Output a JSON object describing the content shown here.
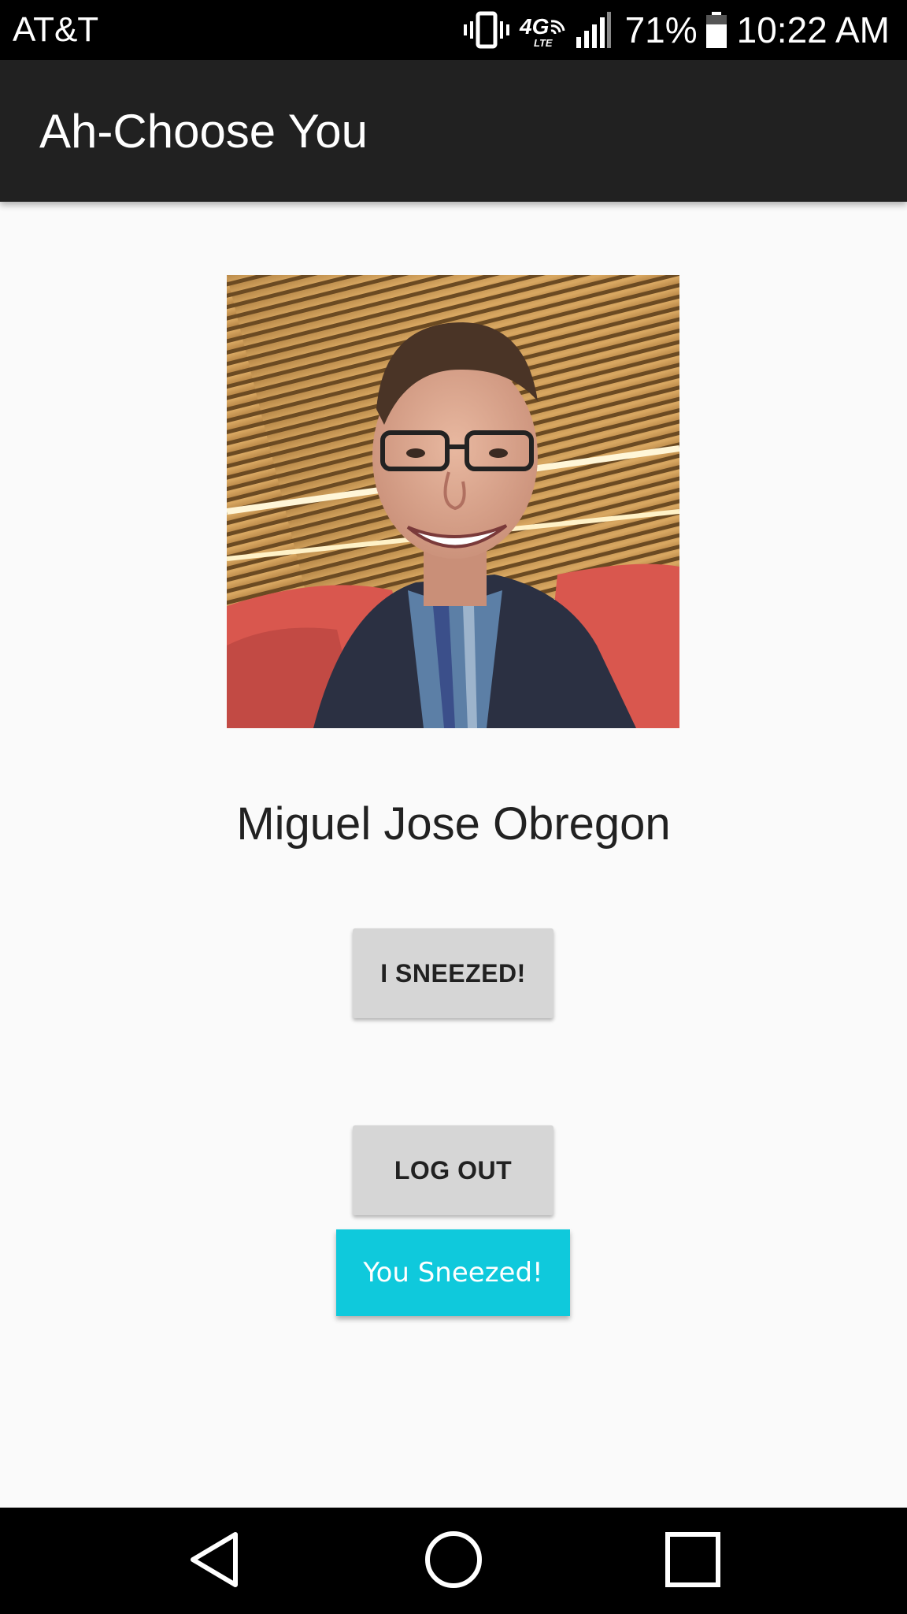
{
  "status_bar": {
    "carrier": "AT&T",
    "network": "4G LTE",
    "battery_percent": "71%",
    "battery_level": 0.71,
    "time": "10:22 AM",
    "icons": [
      "vibrate-icon",
      "4g-lte-icon",
      "signal-icon",
      "battery-icon"
    ]
  },
  "app_bar": {
    "title": "Ah-Choose You"
  },
  "profile": {
    "photo": "profile-photo",
    "name": "Miguel Jose Obregon"
  },
  "buttons": {
    "sneeze_label": "I SNEEZED!",
    "logout_label": "LOG OUT"
  },
  "toast": {
    "message": "You Sneezed!"
  },
  "nav_bar": {
    "icons": [
      "back-icon",
      "home-icon",
      "recents-icon"
    ]
  },
  "colors": {
    "app_bar": "#212121",
    "background": "#fafafa",
    "button": "#d6d6d6",
    "toast": "#0fc9dc"
  }
}
